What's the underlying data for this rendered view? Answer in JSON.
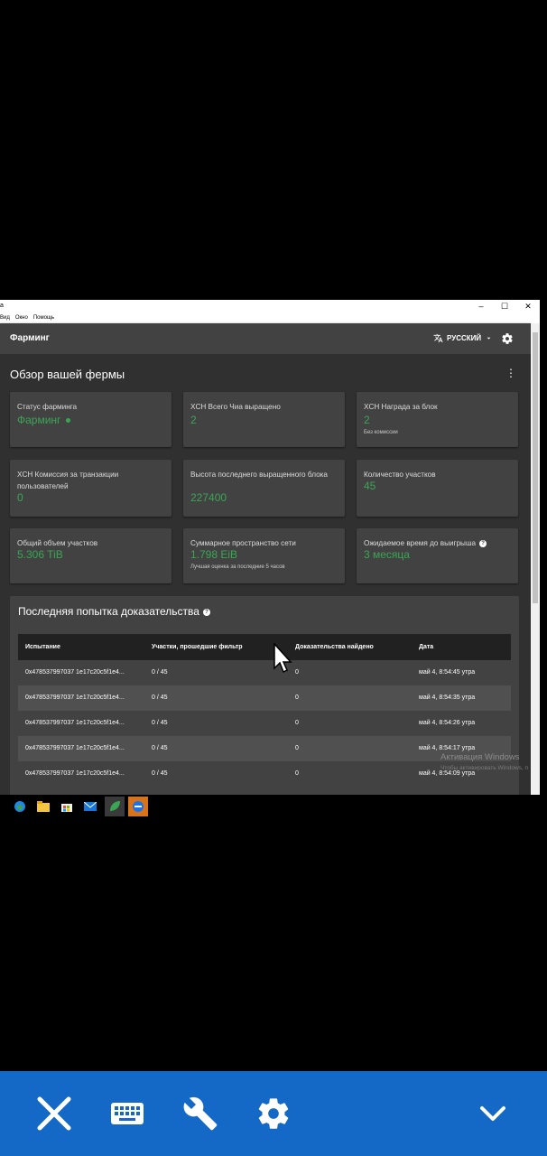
{
  "window": {
    "app_title": "a",
    "menu": [
      "Вид",
      "Окно",
      "Помощь"
    ],
    "controls": [
      "–",
      "☐",
      "✕"
    ]
  },
  "appbar": {
    "title": "Фарминг",
    "language": "РУССКИЙ"
  },
  "overview": {
    "heading": "Обзор вашей фермы",
    "cards": [
      {
        "label": "Статус фарминга",
        "value": "Фарминг"
      },
      {
        "label": "XCH Всего Чиа выращено",
        "value": "2"
      },
      {
        "label": "XCH Награда за блок",
        "value": "2",
        "sub": "Без комиссии"
      },
      {
        "label": "XCH Комиссия за транзакции пользователей",
        "value": "0"
      },
      {
        "label": "Высота последнего выращенного блока",
        "value": "227400"
      },
      {
        "label": "Количество участков",
        "value": "45"
      },
      {
        "label": "Общий объем участков",
        "value": "5.306 TiB"
      },
      {
        "label": "Суммарное пространство сети",
        "value": "1.798 EiB",
        "sub": "Лучшая оценка за последние 5 часов"
      },
      {
        "label": "Ожидаемое время до выигрыша",
        "value": "3 месяца"
      }
    ]
  },
  "proofs": {
    "heading": "Последняя попытка доказательства",
    "columns": [
      "Испытание",
      "Участки, прошедшие фильтр",
      "Доказательства найдено",
      "Дата"
    ],
    "rows": [
      [
        "0x478537997037 1e17c20c5f1e4...",
        "0 / 45",
        "0",
        "май 4, 8:54:45 утра"
      ],
      [
        "0x478537997037 1e17c20c5f1e4...",
        "0 / 45",
        "0",
        "май 4, 8:54:35 утра"
      ],
      [
        "0x478537997037 1e17c20c5f1e4...",
        "0 / 45",
        "0",
        "май 4, 8:54:26 утра"
      ],
      [
        "0x478537997037 1e17c20c5f1e4...",
        "0 / 45",
        "0",
        "май 4, 8:54:17 утра"
      ],
      [
        "0x478537997037 1e17c20c5f1e4...",
        "0 / 45",
        "0",
        "май 4, 8:54:09 утра"
      ]
    ]
  },
  "watermark": {
    "line1": "Активация Windows",
    "line2": "Чтобы активировать Windows, п"
  },
  "colors": {
    "accent": "#3aa655",
    "background": "#303030",
    "card": "#424242",
    "bottom_bar": "#1469c7"
  },
  "icons": {
    "bottom_bar": [
      "close-icon",
      "keyboard-icon",
      "wrench-icon",
      "settings-gear-icon",
      "chevron-down-icon"
    ],
    "taskbar": [
      "edge-icon",
      "file-explorer-icon",
      "store-icon",
      "mail-icon",
      "chia-app-icon",
      "teamviewer-icon"
    ]
  }
}
